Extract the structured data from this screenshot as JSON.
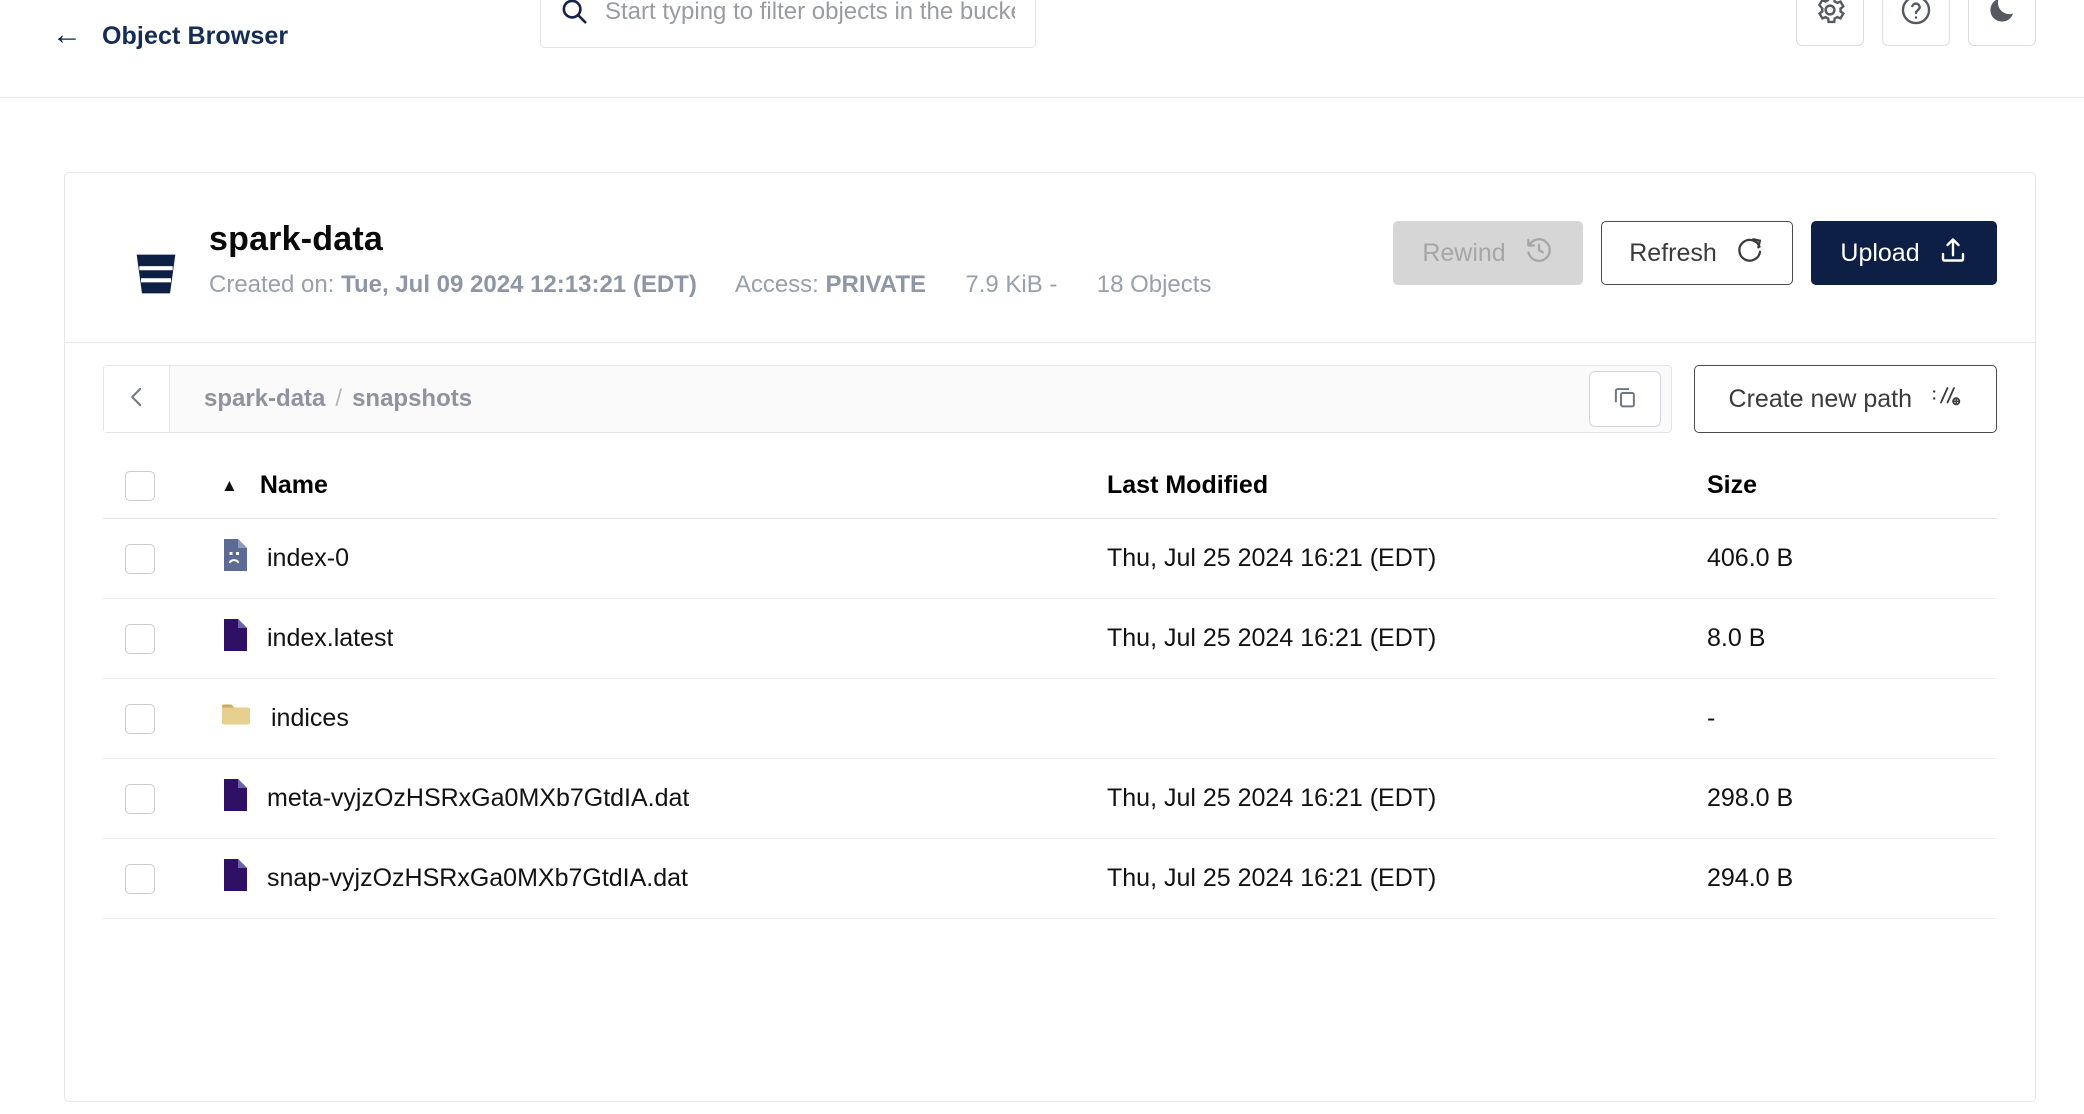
{
  "header": {
    "back_label": "Object Browser",
    "back_icon": "arrow-left-icon",
    "search": {
      "placeholder": "Start typing to filter objects in the bucket",
      "value": "",
      "icon": "search-icon"
    },
    "tools": [
      {
        "name": "settings-button",
        "icon": "gear-icon"
      },
      {
        "name": "help-button",
        "icon": "question-circle-icon"
      },
      {
        "name": "dark-mode-toggle",
        "icon": "moon-icon"
      }
    ]
  },
  "bucket": {
    "icon": "bucket-icon",
    "name": "spark-data",
    "created_label": "Created on:",
    "created_value": "Tue, Jul 09 2024 12:13:21 (EDT)",
    "access_label": "Access:",
    "access_value": "PRIVATE",
    "size": "7.9 KiB -",
    "objects": "18 Objects",
    "actions": {
      "rewind_label": "Rewind",
      "rewind_icon": "rewind-clock-icon",
      "rewind_disabled": true,
      "refresh_label": "Refresh",
      "refresh_icon": "refresh-icon",
      "upload_label": "Upload",
      "upload_icon": "upload-icon"
    }
  },
  "breadcrumb": {
    "back_icon": "chevron-left-icon",
    "segments": [
      "spark-data",
      "snapshots"
    ],
    "separator": "/",
    "copy_icon": "copy-icon",
    "create_path_label": "Create new path",
    "create_path_icon": "path-icon"
  },
  "table": {
    "columns": {
      "name": "Name",
      "last_modified": "Last Modified",
      "size": "Size"
    },
    "sort": {
      "column": "Name",
      "direction": "asc",
      "caret": "▲"
    },
    "rows": [
      {
        "icon": "file-unknown-icon",
        "name": "index-0",
        "last_modified": "Thu, Jul 25 2024 16:21 (EDT)",
        "size": "406.0 B"
      },
      {
        "icon": "file-icon",
        "name": "index.latest",
        "last_modified": "Thu, Jul 25 2024 16:21 (EDT)",
        "size": "8.0 B"
      },
      {
        "icon": "folder-icon",
        "name": "indices",
        "last_modified": "",
        "size": "-"
      },
      {
        "icon": "file-icon",
        "name": "meta-vyjzOzHSRxGa0MXb7GtdIA.dat",
        "last_modified": "Thu, Jul 25 2024 16:21 (EDT)",
        "size": "298.0 B"
      },
      {
        "icon": "file-icon",
        "name": "snap-vyjzOzHSRxGa0MXb7GtdIA.dat",
        "last_modified": "Thu, Jul 25 2024 16:21 (EDT)",
        "size": "294.0 B"
      }
    ]
  },
  "colors": {
    "brand_navy": "#0d1f44",
    "file_purple": "#2e1065",
    "file_blue_gray": "#5c6a94",
    "folder_tan": "#e6cf8f",
    "muted_text": "#98a0ad"
  }
}
